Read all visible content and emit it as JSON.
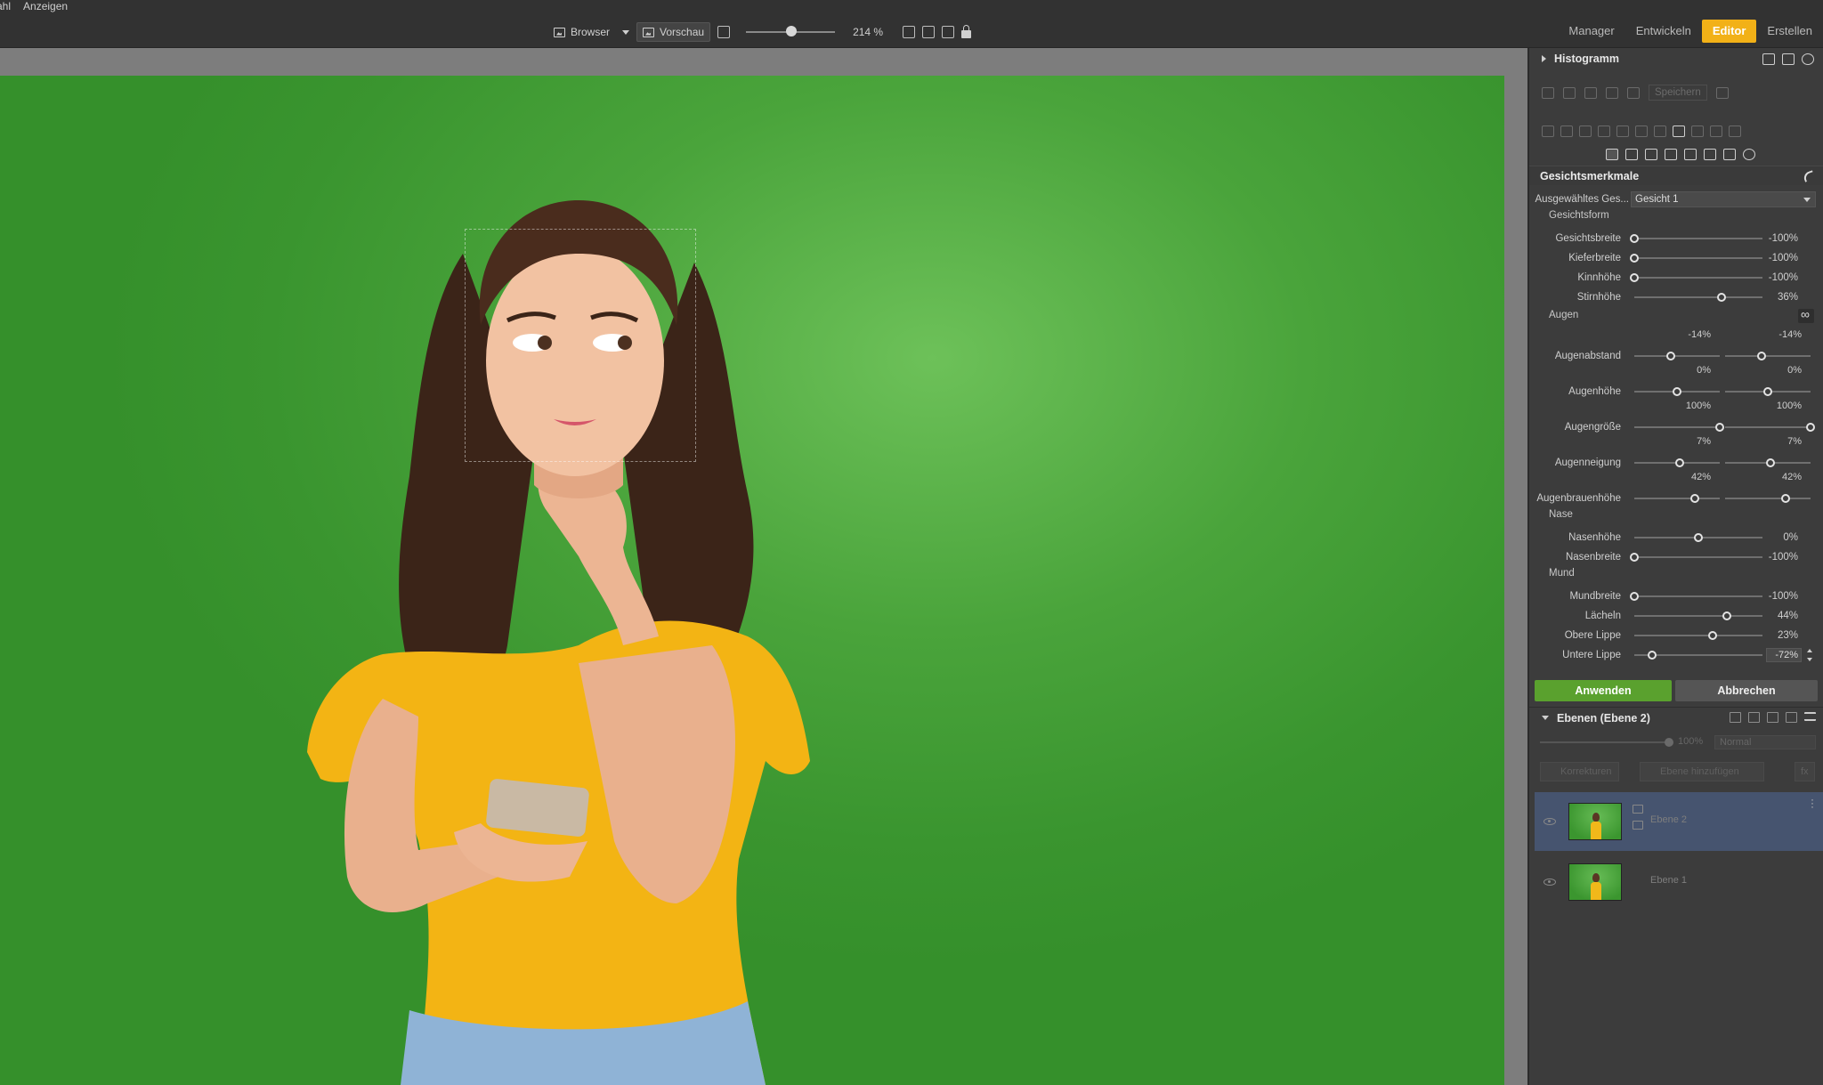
{
  "menu": [
    "ahl",
    "Anzeigen"
  ],
  "toolbar": {
    "browser_label": "Browser",
    "preview_label": "Vorschau",
    "zoom_value": "214 %",
    "zoom_level": 0.45
  },
  "modules": [
    "Manager",
    "Entwickeln",
    "Editor",
    "Erstellen"
  ],
  "active_module": "Editor",
  "panel": {
    "histogram_title": "Histogramm",
    "save_label": "Speichern",
    "section_title": "Gesichtsmerkmale",
    "selected_face_label": "Ausgewähltes Ges...",
    "selected_face_value": "Gesicht 1",
    "groups": {
      "face_shape": "Gesichtsform",
      "eyes": "Augen",
      "nose": "Nase",
      "mouth": "Mund"
    },
    "face_sliders": [
      {
        "label": "Gesichtsbreite",
        "value": "-100%",
        "pos": 0.0
      },
      {
        "label": "Kieferbreite",
        "value": "-100%",
        "pos": 0.0
      },
      {
        "label": "Kinnhöhe",
        "value": "-100%",
        "pos": 0.0
      },
      {
        "label": "Stirnhöhe",
        "value": "36%",
        "pos": 0.68
      }
    ],
    "eye_sliders": [
      {
        "label": "Augenabstand",
        "left": "-14%",
        "right": "-14%",
        "lpos": 0.43,
        "rpos": 0.43
      },
      {
        "label": "Augenhöhe",
        "left": "0%",
        "right": "0%",
        "lpos": 0.5,
        "rpos": 0.5
      },
      {
        "label": "Augengröße",
        "left": "100%",
        "right": "100%",
        "lpos": 1.0,
        "rpos": 1.0
      },
      {
        "label": "Augenneigung",
        "left": "7%",
        "right": "7%",
        "lpos": 0.53,
        "rpos": 0.53
      },
      {
        "label": "Augenbrauenhöhe",
        "left": "42%",
        "right": "42%",
        "lpos": 0.71,
        "rpos": 0.71
      }
    ],
    "nose_sliders": [
      {
        "label": "Nasenhöhe",
        "value": "0%",
        "pos": 0.5
      },
      {
        "label": "Nasenbreite",
        "value": "-100%",
        "pos": 0.0
      }
    ],
    "mouth_sliders": [
      {
        "label": "Mundbreite",
        "value": "-100%",
        "pos": 0.0
      },
      {
        "label": "Lächeln",
        "value": "44%",
        "pos": 0.72
      },
      {
        "label": "Obere Lippe",
        "value": "23%",
        "pos": 0.61
      },
      {
        "label": "Untere Lippe",
        "value": "-72%",
        "pos": 0.14
      }
    ],
    "apply_label": "Anwenden",
    "cancel_label": "Abbrechen",
    "layers_title": "Ebenen (Ebene 2)",
    "opacity_value": "100%",
    "blend_mode": "Normal",
    "corrections_label": "Korrekturen",
    "add_layer_label": "Ebene hinzufügen",
    "fx_label": "fx",
    "layers": [
      {
        "name": "Ebene 2",
        "selected": true
      },
      {
        "name": "Ebene 1",
        "selected": false
      }
    ]
  },
  "colors": {
    "accent_editor": "#f2b117",
    "apply_green": "#5aa12e",
    "backdrop_green": "#4aa43b",
    "selected_layer": "#46546f"
  }
}
